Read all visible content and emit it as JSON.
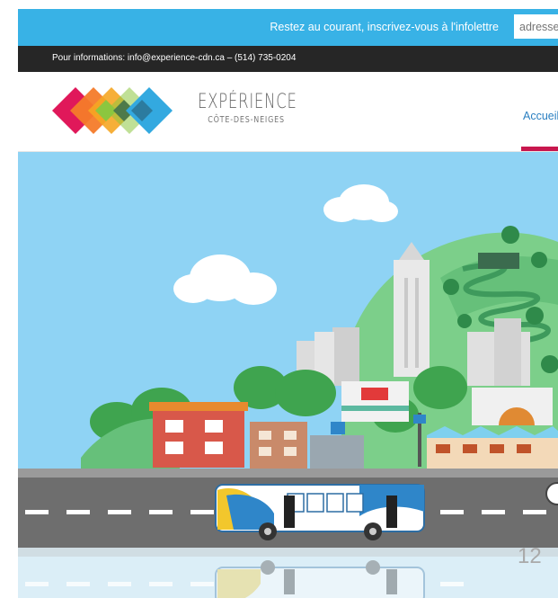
{
  "topbar": {
    "newsletter_text": "Restez au courant, inscrivez-vous à l'infolettre",
    "email_placeholder": "adresse"
  },
  "infobar": {
    "contact_text": "Pour informations: info@experience-cdn.ca – (514) 735-0204"
  },
  "header": {
    "logo_title": "EXPÉRIENCE",
    "logo_subtitle": "CÔTE-DES-NEIGES",
    "nav_items": [
      "Accueil"
    ]
  },
  "colors": {
    "topbar": "#38b2e6",
    "infobar": "#262626",
    "nav_active": "#c8174e",
    "sky": "#8fd3f4",
    "logo": [
      "#e0185a",
      "#f47b2a",
      "#8cc63f",
      "#33a9e0"
    ]
  },
  "slide": {
    "page_number": "12"
  }
}
